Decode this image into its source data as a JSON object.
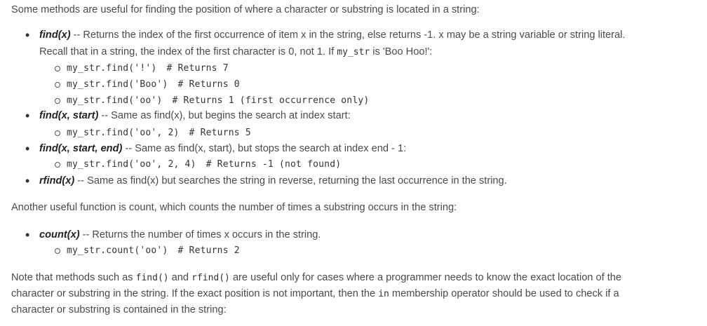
{
  "intro": "Some methods are useful for finding the position of where a character or substring is located in a string:",
  "find": {
    "term": "find(x)",
    "desc_a": " -- Returns the index of the first occurrence of item x in the string, else returns -1. x may be a string variable or string literal.",
    "desc_b1": "Recall that in a string, the index of the first character is 0, not 1. If ",
    "desc_b_code": "my_str",
    "desc_b2": " is 'Boo Hoo!':",
    "examples": [
      {
        "code": "my_str.find('!')",
        "comment": "# Returns 7"
      },
      {
        "code": "my_str.find('Boo')",
        "comment": "# Returns 0"
      },
      {
        "code": "my_str.find('oo')",
        "comment": "# Returns 1 (first occurrence only)"
      }
    ]
  },
  "find_start": {
    "term": "find(x, start)",
    "desc": " -- Same as find(x), but begins the search at index start:",
    "example": {
      "code": "my_str.find('oo', 2)",
      "comment": "# Returns 5"
    }
  },
  "find_start_end": {
    "term": "find(x, start, end)",
    "desc": " -- Same as find(x, start), but stops the search at index end - 1:",
    "example": {
      "code": "my_str.find('oo', 2, 4)",
      "comment": "# Returns -1 (not found)"
    }
  },
  "rfind": {
    "term": "rfind(x)",
    "desc": " -- Same as find(x) but searches the string in reverse, returning the last occurrence in the string."
  },
  "count_intro": "Another useful function is count, which counts the number of times a substring occurs in the string:",
  "count": {
    "term": "count(x)",
    "desc": " -- Returns the number of times x occurs in the string.",
    "example": {
      "code": "my_str.count('oo')",
      "comment": "# Returns 2"
    }
  },
  "note": {
    "t1": "Note that methods such as ",
    "c1": "find()",
    "t2": " and ",
    "c2": "rfind()",
    "t3": " are useful only for cases where a programmer needs to know the exact location of the",
    "line2a": "character or substring in the string. If the exact position is not important, then the ",
    "c3": "in",
    "line2b": " membership operator should be used to check if a",
    "line3": "character or substring is contained in the string:"
  }
}
